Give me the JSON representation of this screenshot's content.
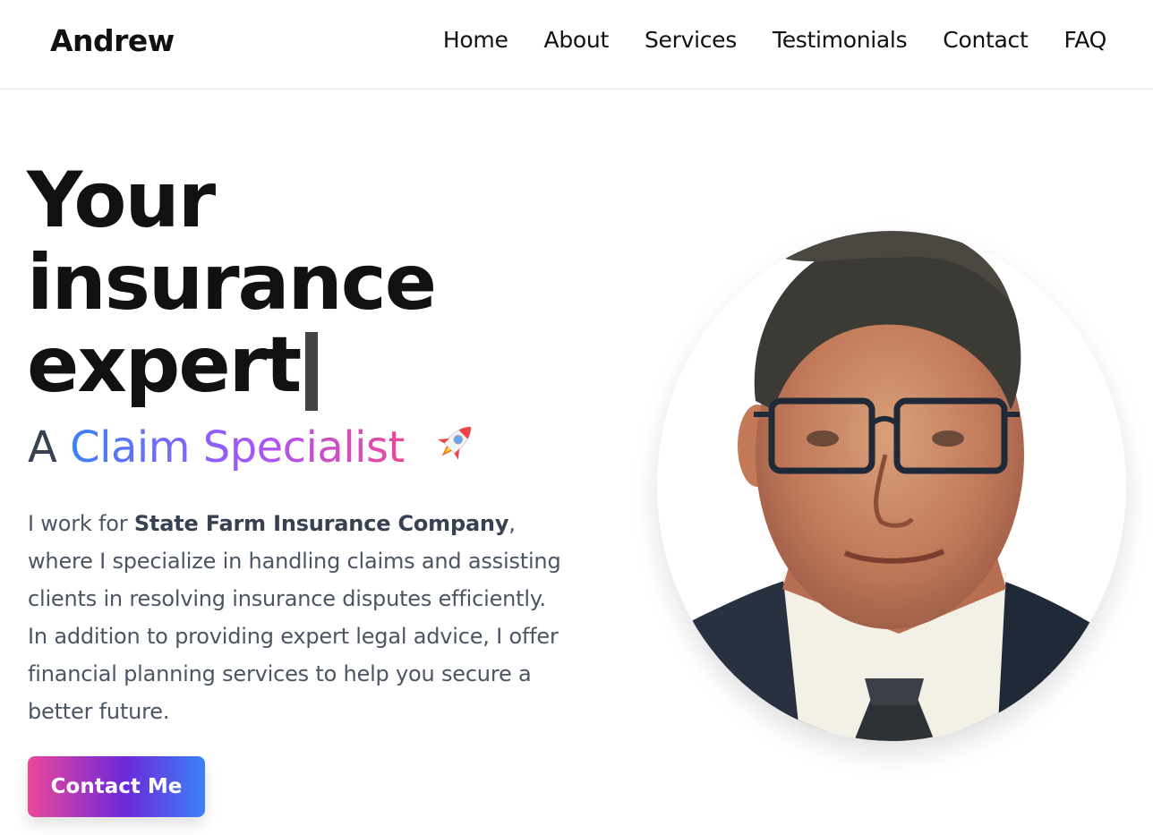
{
  "nav": {
    "brand": "Andrew",
    "links": [
      "Home",
      "About",
      "Services",
      "Testimonials",
      "Contact",
      "FAQ"
    ]
  },
  "hero": {
    "title_lines": [
      "Your",
      "insurance",
      "expert"
    ],
    "subtitle_prefix": "A",
    "subtitle_highlight": "Claim Specialist",
    "subtitle_icon": "rocket-icon",
    "intro_before": "I work for ",
    "intro_company": "State Farm Insurance Company",
    "intro_after": ", where I specialize in handling claims and assisting clients in resolving insurance disputes efficiently.",
    "intro_second": "In addition to providing expert legal advice, I offer financial planning services to help you secure a better future.",
    "button_label": "Contact Me"
  },
  "portrait": {
    "icon": "profile-photo"
  },
  "colors": {
    "gradient_blue": "#3b82f6",
    "gradient_purple": "#a855f7",
    "gradient_pink": "#ec4899",
    "text_dark": "#111111",
    "text_body": "#4b5563"
  }
}
